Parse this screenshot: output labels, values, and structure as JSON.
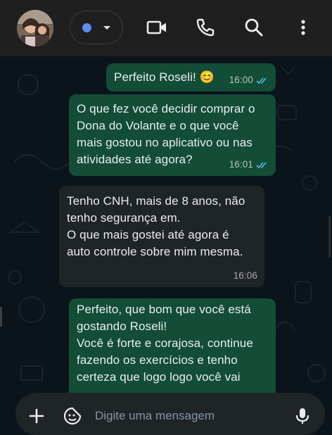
{
  "header": {
    "contact_avatar": "contact-photo",
    "status_color": "#5b8def",
    "icons": [
      "video-call-icon",
      "voice-call-icon",
      "search-icon",
      "more-options-icon"
    ]
  },
  "messages": [
    {
      "direction": "outgoing",
      "text": "Perfeito Roseli! 😊",
      "time": "16:00",
      "status": "read"
    },
    {
      "direction": "outgoing",
      "text": "O que fez você decidir comprar o\nDona do Volante e o que você\nmais gostou no aplicativo ou nas\natividades até agora?",
      "time": "16:01",
      "status": "read"
    },
    {
      "direction": "incoming",
      "text": "Tenho CNH, mais de 8 anos, não\ntenho segurança em.\nO que mais gostei até agora é\nauto controle sobre mim mesma.",
      "time": "16:06"
    },
    {
      "direction": "outgoing",
      "text": "Perfeito, que bom que você está\ngostando Roseli!\nVocê é forte e corajosa, continue\nfazendo os exercícios e tenho\ncerteza que logo logo você vai"
    }
  ],
  "composer": {
    "placeholder": "Digite uma mensagem",
    "icons": [
      "plus-icon",
      "sticker-icon",
      "microphone-icon"
    ]
  },
  "colors": {
    "outgoing_bubble": "#134d37",
    "incoming_bubble": "#1f2427",
    "read_ticks": "#53bdeb",
    "background": "#0b141a"
  }
}
